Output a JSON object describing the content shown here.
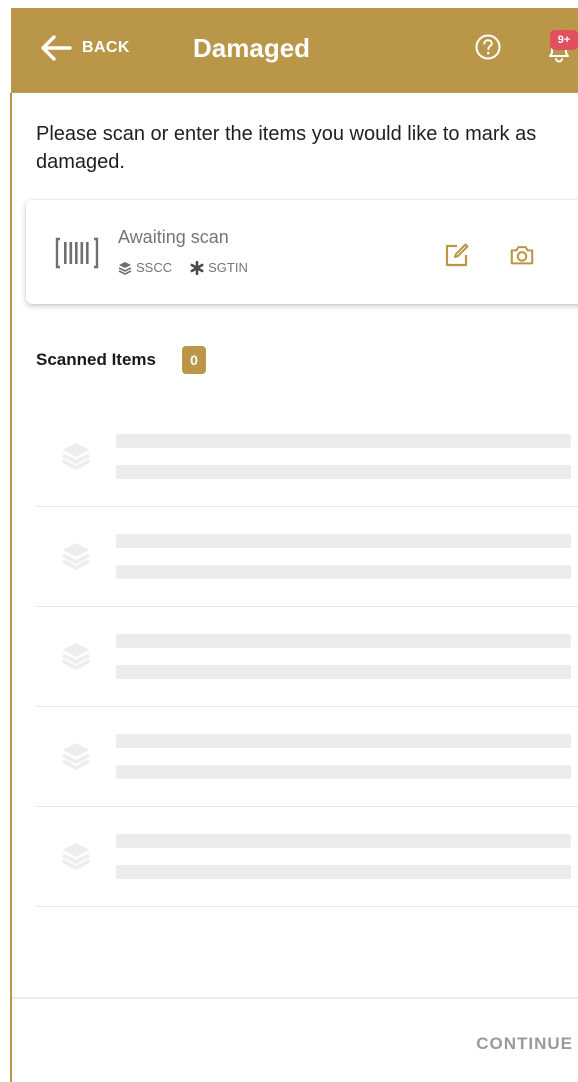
{
  "header": {
    "back_label": "BACK",
    "title": "Damaged",
    "notification_count": "9+",
    "help_icon": "help-circle-icon",
    "bell_icon": "bell-icon"
  },
  "instruction": "Please scan or enter the items you would like to mark as damaged.",
  "scan_card": {
    "status": "Awaiting scan",
    "types": [
      "SSCC",
      "SGTIN"
    ],
    "barcode_icon": "barcode-icon",
    "edit_icon": "edit-icon",
    "camera_icon": "camera-icon"
  },
  "scanned_items": {
    "label": "Scanned Items",
    "count": "0",
    "placeholder_rows": 5
  },
  "footer": {
    "continue_label": "CONTINUE"
  },
  "colors": {
    "brand": "#b99648",
    "badge_red": "#e0505f",
    "placeholder": "#ececec"
  }
}
